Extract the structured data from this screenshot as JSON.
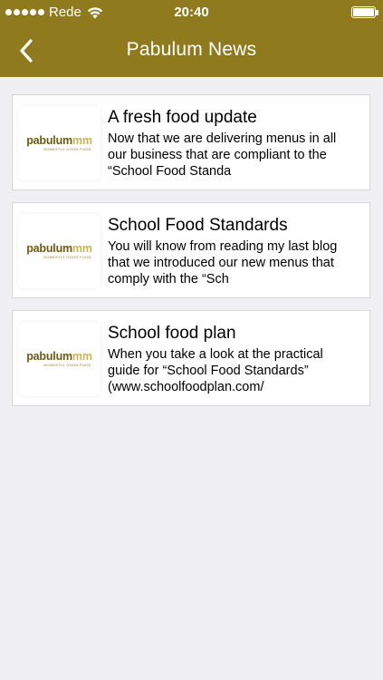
{
  "status_bar": {
    "carrier": "Rede",
    "time": "20:40",
    "battery_level": 1.0
  },
  "nav": {
    "title": "Pabulum News",
    "back_icon": "chevron-left-icon",
    "bar_color": "#8f7b1e"
  },
  "articles": [
    {
      "title": "A fresh food update",
      "excerpt": "Now that we are delivering menus in all our business that are compliant to the “School Food Standa",
      "thumbnail": {
        "logo_main": "pabulum",
        "logo_accent": "mm",
        "tagline": "HONESTLY GOOD FOOD"
      }
    },
    {
      "title": "School Food Standards",
      "excerpt": "You will know from reading my last blog that we introduced our new menus that comply with the “Sch",
      "thumbnail": {
        "logo_main": "pabulum",
        "logo_accent": "mm",
        "tagline": "HONESTLY GOOD FOOD"
      }
    },
    {
      "title": "School food plan",
      "excerpt": "When you take a look at the practical guide for “School Food Standards” (www.schoolfoodplan.com/",
      "thumbnail": {
        "logo_main": "pabulum",
        "logo_accent": "mm",
        "tagline": "HONESTLY GOOD FOOD"
      }
    }
  ]
}
